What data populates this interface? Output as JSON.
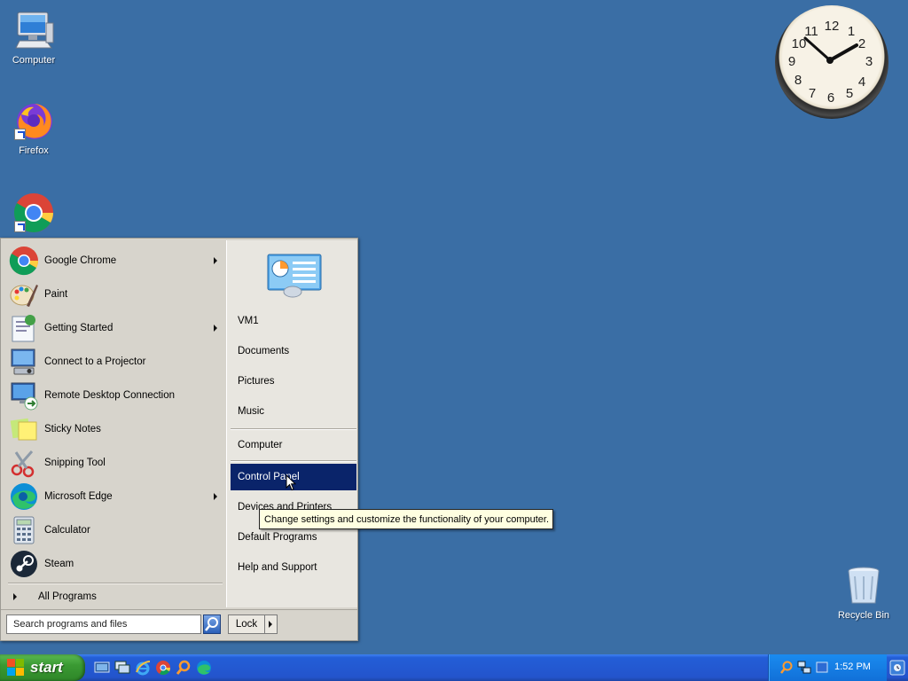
{
  "desktop": {
    "icons": [
      {
        "label": "Computer"
      },
      {
        "label": "Firefox"
      },
      {
        "label": ""
      },
      {
        "label": "Recycle Bin"
      }
    ]
  },
  "clock": {
    "numerals": [
      "12",
      "1",
      "2",
      "3",
      "4",
      "5",
      "6",
      "7",
      "8",
      "9",
      "10",
      "11"
    ],
    "time_shown": "1:52"
  },
  "start_menu": {
    "programs": [
      {
        "label": "Google Chrome",
        "has_submenu": true,
        "icon": "chrome-icon"
      },
      {
        "label": "Paint",
        "has_submenu": false,
        "icon": "paint-icon"
      },
      {
        "label": "Getting Started",
        "has_submenu": true,
        "icon": "getting-started-icon"
      },
      {
        "label": "Connect to a Projector",
        "has_submenu": false,
        "icon": "projector-icon"
      },
      {
        "label": "Remote Desktop Connection",
        "has_submenu": false,
        "icon": "remote-desktop-icon"
      },
      {
        "label": "Sticky Notes",
        "has_submenu": false,
        "icon": "sticky-notes-icon"
      },
      {
        "label": "Snipping Tool",
        "has_submenu": false,
        "icon": "snipping-tool-icon"
      },
      {
        "label": "Microsoft Edge",
        "has_submenu": true,
        "icon": "edge-icon"
      },
      {
        "label": "Calculator",
        "has_submenu": false,
        "icon": "calculator-icon"
      },
      {
        "label": "Steam",
        "has_submenu": false,
        "icon": "steam-icon"
      }
    ],
    "all_programs": "All Programs",
    "right_items": [
      {
        "label": "VM1"
      },
      {
        "label": "Documents"
      },
      {
        "label": "Pictures"
      },
      {
        "label": "Music"
      },
      {
        "label": "Computer"
      },
      {
        "label": "Control Panel",
        "selected": true
      },
      {
        "label": "Devices and Printers"
      },
      {
        "label": "Default Programs"
      },
      {
        "label": "Help and Support"
      }
    ],
    "search_placeholder": "Search programs and files",
    "lock_label": "Lock",
    "tooltip": "Change settings and customize the functionality of your computer."
  },
  "taskbar": {
    "start_label": "start",
    "quick_launch": [
      "show-desktop-icon",
      "switch-windows-icon",
      "ie-icon",
      "chrome-icon",
      "search-icon",
      "edge-icon"
    ],
    "time": "1:52 PM"
  },
  "colors": {
    "desktop": "#3a6ea5",
    "selection": "#0a246a",
    "taskbar": "#2354cc",
    "start_button": "#3a9a33",
    "tooltip": "#ffffe1"
  }
}
